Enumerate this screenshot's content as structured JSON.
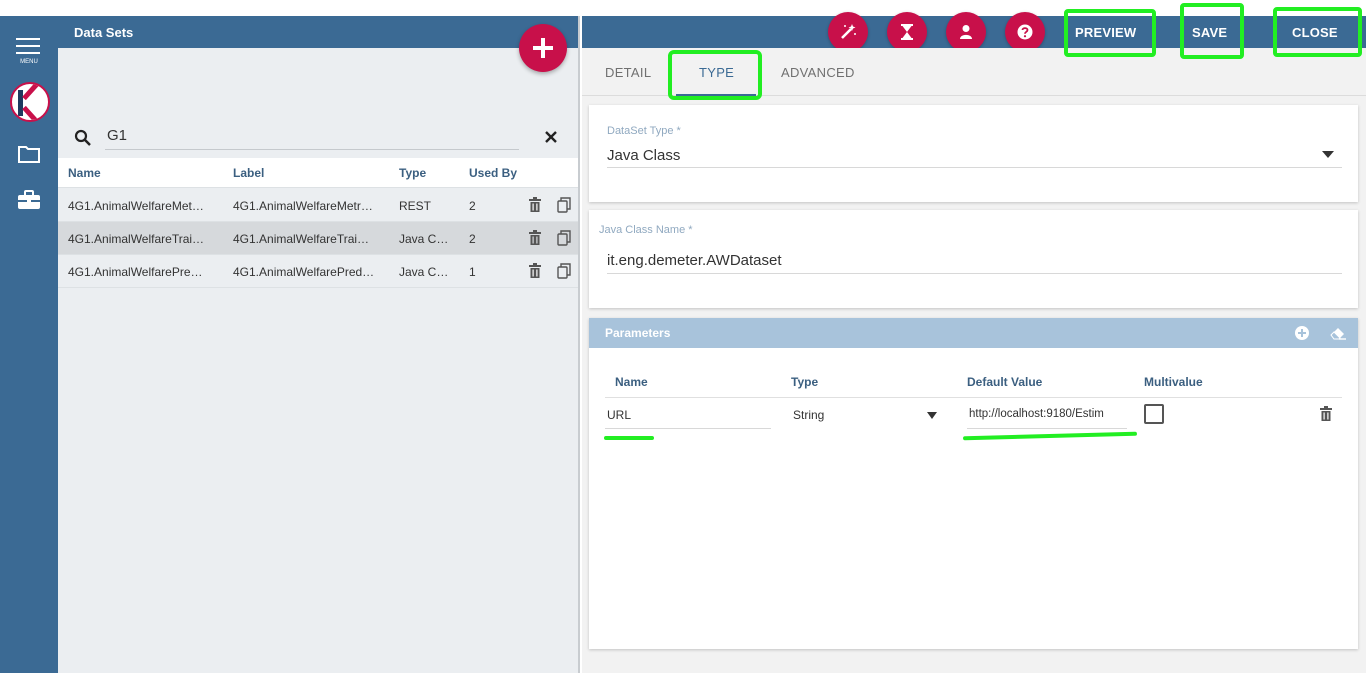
{
  "sidebar": {
    "menu_label": "MENU",
    "icons": [
      "menu-icon",
      "knowage-logo",
      "folder-icon",
      "briefcase-icon"
    ]
  },
  "list": {
    "title": "Data Sets",
    "search_value": "G1",
    "columns": [
      "Name",
      "Label",
      "Type",
      "Used By"
    ],
    "rows": [
      {
        "name": "4G1.AnimalWelfareMet…",
        "label": "4G1.AnimalWelfareMetr…",
        "type": "REST",
        "used_by": "2"
      },
      {
        "name": "4G1.AnimalWelfareTrai…",
        "label": "4G1.AnimalWelfareTrai…",
        "type": "Java C…",
        "used_by": "2"
      },
      {
        "name": "4G1.AnimalWelfarePre…",
        "label": "4G1.AnimalWelfarePred…",
        "type": "Java C…",
        "used_by": "1"
      }
    ],
    "selected_row": 1
  },
  "toolbar": {
    "preview": "PREVIEW",
    "save": "SAVE",
    "close": "CLOSE",
    "icons": [
      "magic-wand-icon",
      "hourglass-icon",
      "user-icon",
      "help-icon"
    ]
  },
  "tabs": {
    "detail": "DETAIL",
    "type": "TYPE",
    "advanced": "ADVANCED",
    "active": "TYPE"
  },
  "dataset_type": {
    "label": "DataSet Type *",
    "value": "Java Class"
  },
  "java_class": {
    "label": "Java Class Name *",
    "value": "it.eng.demeter.AWDataset"
  },
  "parameters": {
    "title": "Parameters",
    "columns": {
      "name": "Name",
      "type": "Type",
      "default_value": "Default Value",
      "multivalue": "Multivalue"
    },
    "rows": [
      {
        "name": "URL",
        "type": "String",
        "default_value": "http://localhost:9180/Estim",
        "multivalue": false
      }
    ]
  },
  "colors": {
    "primary": "#3b6a94",
    "accent": "#c8104a",
    "params_header": "#a8c3db",
    "annotation": "#22ee22"
  }
}
